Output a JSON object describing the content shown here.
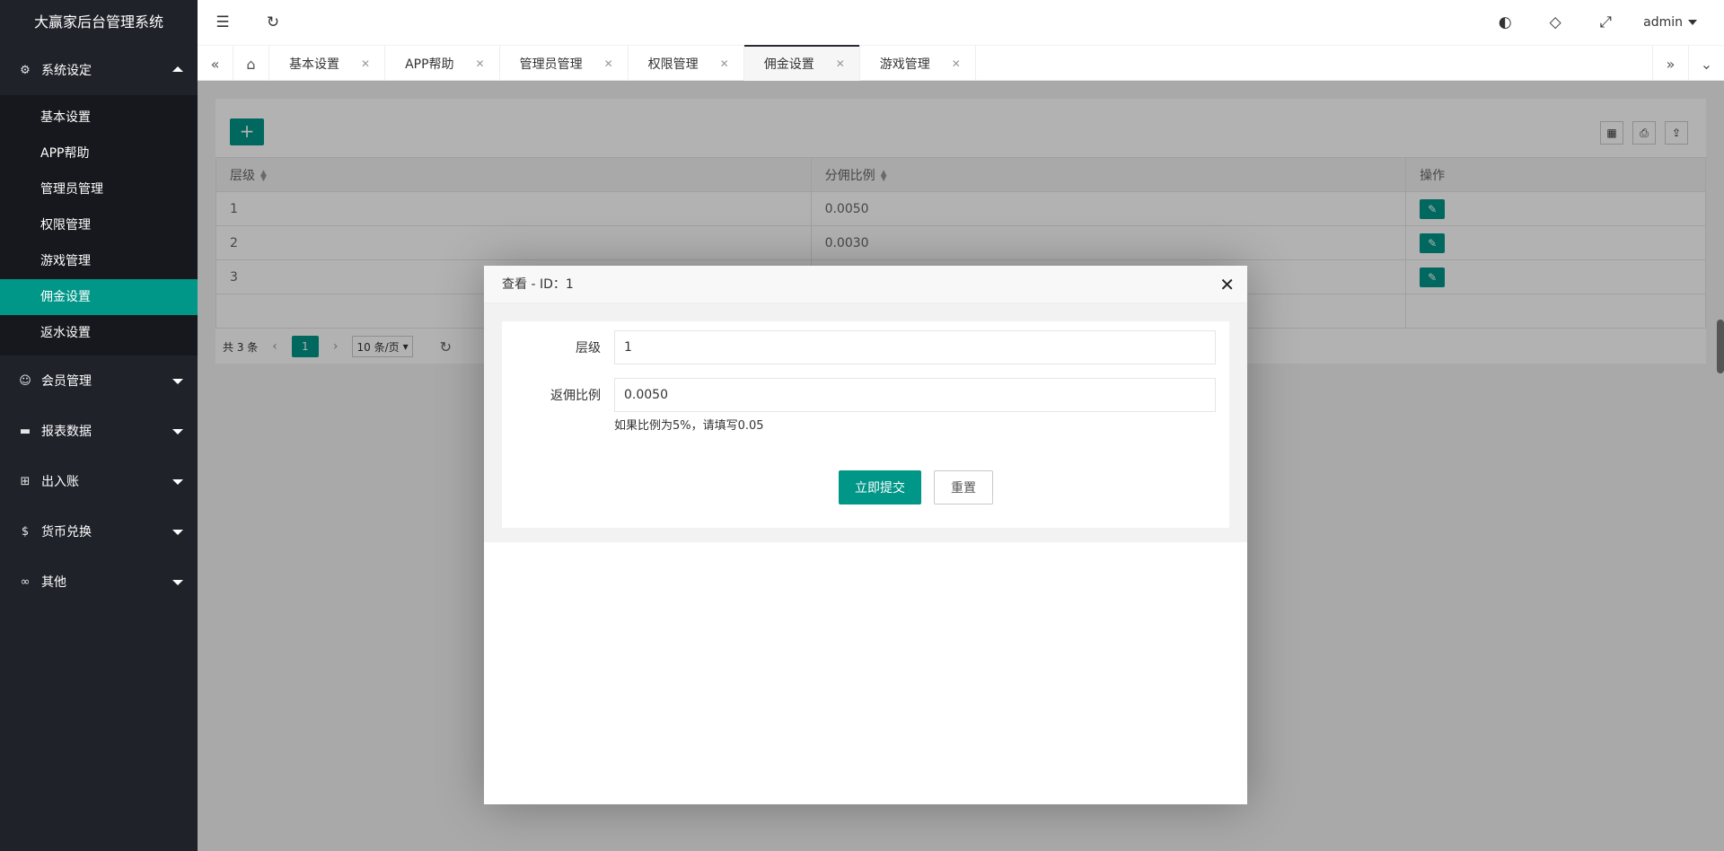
{
  "app": {
    "title": "大赢家后台管理系统"
  },
  "sidebar": {
    "groups": [
      {
        "label": "系统设定",
        "icon": "gear-icon",
        "expanded": true,
        "children": [
          "基本设置",
          "APP帮助",
          "管理员管理",
          "权限管理",
          "游戏管理",
          "佣金设置",
          "返水设置"
        ],
        "active_child": "佣金设置"
      },
      {
        "label": "会员管理",
        "icon": "user-icon",
        "expanded": false
      },
      {
        "label": "报表数据",
        "icon": "report-icon",
        "expanded": false
      },
      {
        "label": "出入账",
        "icon": "ledger-icon",
        "expanded": false
      },
      {
        "label": "货币兑换",
        "icon": "currency-icon",
        "expanded": false
      },
      {
        "label": "其他",
        "icon": "infinity-icon",
        "expanded": false
      }
    ]
  },
  "header": {
    "user": "admin"
  },
  "tabs": {
    "items": [
      "基本设置",
      "APP帮助",
      "管理员管理",
      "权限管理",
      "佣金设置",
      "游戏管理"
    ],
    "active": "佣金设置"
  },
  "table": {
    "columns": [
      "层级",
      "分佣比例",
      "操作"
    ],
    "rows": [
      {
        "level": "1",
        "ratio": "0.0050"
      },
      {
        "level": "2",
        "ratio": "0.0030"
      },
      {
        "level": "3",
        "ratio": ""
      }
    ]
  },
  "pager": {
    "total": "共 3 条",
    "current": "1",
    "page_size": "10 条/页"
  },
  "modal": {
    "title": "查看 - ID：1",
    "fields": [
      {
        "label": "层级",
        "value": "1"
      },
      {
        "label": "返佣比例",
        "value": "0.0050"
      }
    ],
    "tip": "如果比例为5%，请填写0.05",
    "submit": "立即提交",
    "reset": "重置"
  },
  "colors": {
    "accent": "#009688",
    "sidebar": "#20222a",
    "sidebar_sub": "#16181d"
  }
}
